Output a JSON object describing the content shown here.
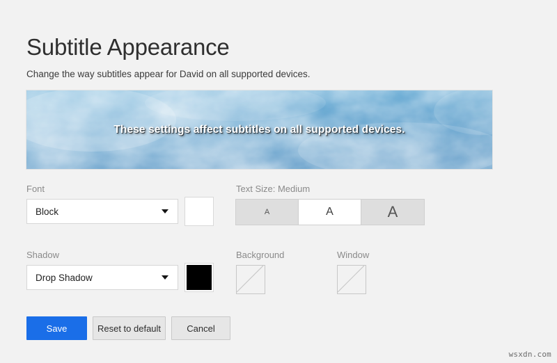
{
  "page": {
    "title": "Subtitle Appearance",
    "description": "Change the way subtitles appear for David on all supported devices."
  },
  "preview": {
    "caption": "These settings affect subtitles on all supported devices.",
    "sky_color": "#3f93c6",
    "cloud_color": "#ffffff",
    "caption_color": "#ffffff"
  },
  "font_field": {
    "label": "Font",
    "value": "Block",
    "caret_icon": "chevron-down-icon",
    "color_swatch": {
      "name": "font-color-swatch",
      "value": "#ffffff"
    }
  },
  "text_size_field": {
    "label": "Text Size: Medium",
    "selected": "Medium",
    "options": [
      {
        "label": "A",
        "size": "Small"
      },
      {
        "label": "A",
        "size": "Medium"
      },
      {
        "label": "A",
        "size": "Large"
      }
    ]
  },
  "shadow_field": {
    "label": "Shadow",
    "value": "Drop Shadow",
    "caret_icon": "chevron-down-icon",
    "color_swatch": {
      "name": "shadow-color-swatch",
      "value": "#000000"
    }
  },
  "background_field": {
    "label": "Background",
    "swatch_state": "none"
  },
  "window_field": {
    "label": "Window",
    "swatch_state": "none"
  },
  "actions": {
    "save": "Save",
    "reset": "Reset to default",
    "cancel": "Cancel",
    "save_color": "#1a6ee8"
  },
  "watermark": "wsxdn.com"
}
